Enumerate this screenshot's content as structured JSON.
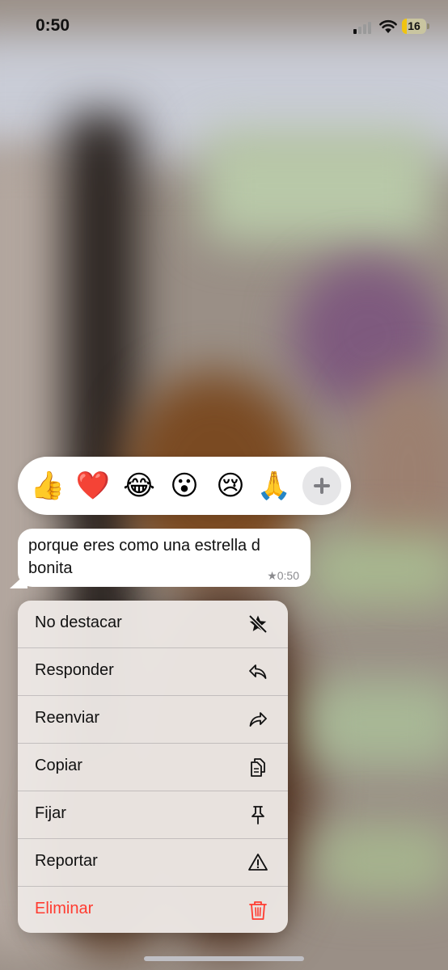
{
  "status_bar": {
    "time": "0:50",
    "battery": "16",
    "icons": [
      "cellular-signal-icon",
      "wifi-icon",
      "battery-icon"
    ]
  },
  "reactions": {
    "emojis": [
      "👍",
      "❤️",
      "😂",
      "😮",
      "😢",
      "🙏"
    ],
    "more_icon": "plus-icon"
  },
  "message": {
    "line1": "porque eres como una estrella d",
    "line2": "bonita",
    "time": "★0:50"
  },
  "menu": {
    "items": [
      {
        "label": "No destacar",
        "icon": "unstar-icon"
      },
      {
        "label": "Responder",
        "icon": "reply-icon"
      },
      {
        "label": "Reenviar",
        "icon": "forward-icon"
      },
      {
        "label": "Copiar",
        "icon": "copy-icon"
      },
      {
        "label": "Fijar",
        "icon": "pin-icon"
      },
      {
        "label": "Reportar",
        "icon": "warning-icon"
      },
      {
        "label": "Eliminar",
        "icon": "trash-icon"
      }
    ]
  },
  "colors": {
    "destructive": "#ff3b30",
    "bubble": "#ffffff",
    "menu_background": "#ece7e4"
  }
}
